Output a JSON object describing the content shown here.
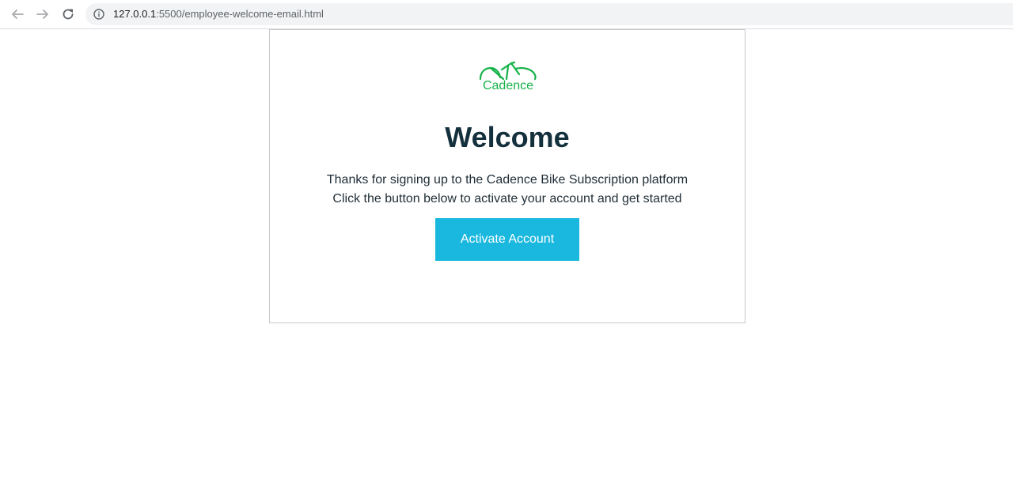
{
  "browser": {
    "url_host": "127.0.0.1",
    "url_rest": ":5500/employee-welcome-email.html"
  },
  "email": {
    "logo_text": "Cadence",
    "headline": "Welcome",
    "body_line_1": "Thanks for signing up to the Cadence Bike Subscription platform",
    "body_line_2": "Click the button below to activate your account and get started",
    "cta_label": "Activate Account"
  },
  "colors": {
    "brand_green": "#17b24a",
    "cta_blue": "#1ab8df",
    "headline": "#13303c"
  },
  "icons": {
    "back": "arrow-left-icon",
    "forward": "arrow-right-icon",
    "reload": "reload-icon",
    "site_info": "info-icon",
    "logo": "bicycle-icon"
  }
}
